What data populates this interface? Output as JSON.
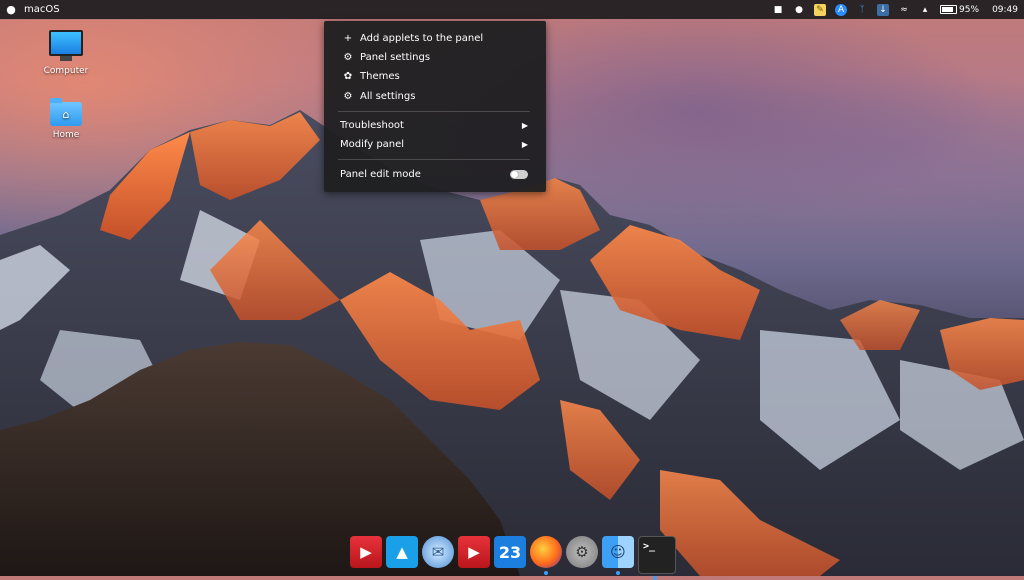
{
  "topbar": {
    "apple_icon": "apple-icon",
    "title": "macOS",
    "tray": {
      "battery_percent": "95%",
      "clock": "09:49",
      "icons": [
        "drive-icon",
        "user-icon",
        "notes-icon",
        "app-store-icon",
        "bluetooth-icon",
        "updates-icon",
        "wifi-icon",
        "volume-icon",
        "battery-icon"
      ]
    }
  },
  "desktop": {
    "icons": [
      {
        "label": "Computer",
        "icon": "computer-icon"
      },
      {
        "label": "Home",
        "icon": "home-folder-icon"
      }
    ]
  },
  "menu": {
    "items": [
      {
        "label": "Add applets to the panel",
        "icon": "plus-icon"
      },
      {
        "label": "Panel settings",
        "icon": "gear-icon"
      },
      {
        "label": "Themes",
        "icon": "themes-icon"
      },
      {
        "label": "All settings",
        "icon": "gear-icon"
      }
    ],
    "submenus": [
      {
        "label": "Troubleshoot"
      },
      {
        "label": "Modify panel"
      }
    ],
    "edit_mode": {
      "label": "Panel edit mode",
      "enabled": false
    }
  },
  "dock": {
    "apps": [
      {
        "name": "video-player-icon",
        "active": false
      },
      {
        "name": "app-icon",
        "active": false
      },
      {
        "name": "mail-icon",
        "active": false
      },
      {
        "name": "video-player-icon",
        "active": false
      },
      {
        "name": "calendar-icon",
        "text": "23",
        "active": false
      },
      {
        "name": "firefox-icon",
        "active": true
      },
      {
        "name": "settings-icon",
        "active": false
      },
      {
        "name": "finder-icon",
        "active": true
      },
      {
        "name": "terminal-icon",
        "active": true
      }
    ]
  }
}
